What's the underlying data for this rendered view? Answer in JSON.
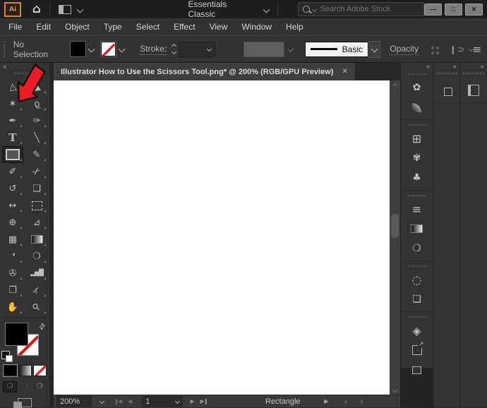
{
  "titlebar": {
    "app_logo": "Ai",
    "workspace_switcher": "Essentials Classic",
    "search_placeholder": "Search Adobe Stock",
    "minimize_glyph": "—",
    "maximize_glyph": "□",
    "close_glyph": "✕"
  },
  "menubar": {
    "items": [
      {
        "name": "menu-file",
        "label": "File"
      },
      {
        "name": "menu-edit",
        "label": "Edit"
      },
      {
        "name": "menu-object",
        "label": "Object"
      },
      {
        "name": "menu-type",
        "label": "Type"
      },
      {
        "name": "menu-select",
        "label": "Select"
      },
      {
        "name": "menu-effect",
        "label": "Effect"
      },
      {
        "name": "menu-view",
        "label": "View"
      },
      {
        "name": "menu-window",
        "label": "Window"
      },
      {
        "name": "menu-help",
        "label": "Help"
      }
    ]
  },
  "control_bar": {
    "selection_status": "No Selection",
    "stroke_label": "Stroke:",
    "brush_style_value": "Basic",
    "opacity_label": "Opacity",
    "isolate_glyph": "❙⊃",
    "panel_menu_glyph": "≡"
  },
  "document_tab": {
    "title": "Illustrator How to Use the Scissors Tool.png* @ 200% (RGB/GPU Preview)",
    "close_glyph": "✕"
  },
  "icons": {
    "collapse": "«",
    "swap_colors": "⇄"
  },
  "toolbar": {
    "tools": [
      {
        "name": "selection-tool",
        "glyph": "▷",
        "rot": -100
      },
      {
        "name": "direct-selection-tool",
        "glyph": "▶",
        "rot": -100
      },
      {
        "name": "magic-wand-tool",
        "glyph": "✶"
      },
      {
        "name": "lasso-tool",
        "glyph": "ϱ",
        "rot": -20
      },
      {
        "name": "pen-tool",
        "glyph": "✒"
      },
      {
        "name": "curvature-tool",
        "glyph": "✑"
      },
      {
        "name": "type-tool",
        "glyph": "T",
        "cls": "t-type"
      },
      {
        "name": "line-segment-tool",
        "glyph": "╲"
      },
      {
        "name": "rectangle-tool",
        "cls": "i-rect",
        "selected": true
      },
      {
        "name": "paintbrush-tool",
        "glyph": "✎"
      },
      {
        "name": "shaper-tool",
        "glyph": "✐"
      },
      {
        "name": "scissors-tool",
        "glyph": "✂",
        "rot": -40
      },
      {
        "name": "rotate-tool",
        "glyph": "↺"
      },
      {
        "name": "scale-tool",
        "glyph": "❏"
      },
      {
        "name": "width-tool",
        "glyph": "↔"
      },
      {
        "name": "free-transform-tool",
        "cls": "i-dash"
      },
      {
        "name": "shape-builder-tool",
        "glyph": "⊕"
      },
      {
        "name": "perspective-grid-tool",
        "glyph": "⊿"
      },
      {
        "name": "mesh-tool",
        "glyph": "▦"
      },
      {
        "name": "gradient-tool",
        "cls": "i-grad"
      },
      {
        "name": "eyedropper-tool",
        "glyph": "❛",
        "rot": 25
      },
      {
        "name": "blend-tool",
        "glyph": "❍"
      },
      {
        "name": "symbol-sprayer-tool",
        "glyph": "✇"
      },
      {
        "name": "column-graph-tool",
        "glyph": "▂▅█",
        "cls": "t-bars"
      },
      {
        "name": "artboard-tool",
        "glyph": "❐"
      },
      {
        "name": "slice-tool",
        "glyph": "✃",
        "rot": -45
      },
      {
        "name": "hand-tool",
        "glyph": "✋"
      },
      {
        "name": "zoom-tool",
        "glyph": "⚲",
        "rot": -45
      }
    ],
    "drawing_modes": [
      {
        "name": "draw-normal-mode",
        "glyph": "❍",
        "selected": true
      },
      {
        "name": "draw-behind-mode",
        "glyph": "❍"
      },
      {
        "name": "draw-inside-mode",
        "glyph": "❍"
      }
    ]
  },
  "dock": {
    "col_a_items": [
      {
        "name": "panel-group-grip",
        "cls": "grip"
      },
      {
        "name": "color-panel-icon",
        "glyph": "✿"
      },
      {
        "name": "color-guide-panel-icon",
        "cls": "i-cguide"
      },
      {
        "name": "panel-group-grip",
        "cls": "grip sep"
      },
      {
        "name": "swatches-panel-icon",
        "glyph": "⊞",
        "cls": "t-big"
      },
      {
        "name": "brushes-panel-icon",
        "glyph": "✾"
      },
      {
        "name": "symbols-panel-icon",
        "glyph": "♣"
      },
      {
        "name": "panel-group-grip",
        "cls": "grip sep"
      },
      {
        "name": "stroke-panel-icon",
        "glyph": "≡",
        "cls": "t-big"
      },
      {
        "name": "gradient-panel-icon",
        "cls": "i-grad"
      },
      {
        "name": "transparency-panel-icon",
        "glyph": "❍"
      },
      {
        "name": "panel-group-grip",
        "cls": "grip sep"
      },
      {
        "name": "appearance-panel-icon",
        "glyph": "◌",
        "cls": "t-big"
      },
      {
        "name": "graphic-styles-panel-icon",
        "glyph": "❏"
      },
      {
        "name": "panel-group-grip",
        "cls": "grip sep"
      },
      {
        "name": "layers-panel-icon",
        "glyph": "◈",
        "cls": "t-big"
      },
      {
        "name": "asset-export-panel-icon",
        "cls": "i-export"
      },
      {
        "name": "artboards-panel-icon",
        "cls": "i-boards"
      }
    ]
  },
  "status_bar": {
    "zoom_value": "200%",
    "artboard_value": "1",
    "current_tool": "Rectangle",
    "first_glyph": "◀",
    "prev_glyph": "◀",
    "next_glyph": "▶",
    "last_glyph": "▶",
    "play_glyph": "▶",
    "chev_left": "‹",
    "chev_right": "›"
  }
}
